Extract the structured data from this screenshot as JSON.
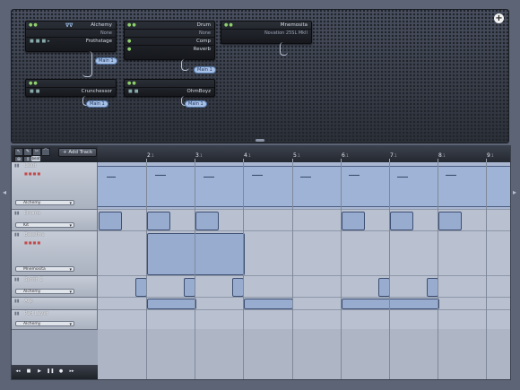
{
  "mixer": {
    "add_symbol": "+",
    "plugins": [
      {
        "name": "Alchemy",
        "sub": "None",
        "fx": "Frothstage"
      },
      {
        "name": "Drum",
        "sub": "None",
        "fx": [
          "Comp",
          "Reverb"
        ]
      },
      {
        "name": "Mnemosita",
        "sub": "Novation 25SL MkII"
      },
      {
        "name": "Crunchessor"
      },
      {
        "name": "OhmBoyz"
      }
    ],
    "outputs": [
      "Main 1",
      "Main 1",
      "Main 1",
      "Main 1"
    ]
  },
  "toolbar": {
    "add_track_label": "+ Add Track",
    "beat_label": "beat",
    "tools": [
      "pointer-tool",
      "pencil-tool",
      "scissors-tool",
      "glue-tool"
    ]
  },
  "ruler": {
    "marks": [
      {
        "n": "2",
        "s": ".1"
      },
      {
        "n": "3",
        "s": ".1"
      },
      {
        "n": "4",
        "s": ".1"
      },
      {
        "n": "5",
        "s": ".1"
      },
      {
        "n": "6",
        "s": ".1"
      },
      {
        "n": "7",
        "s": ".1"
      },
      {
        "n": "8",
        "s": ".1"
      },
      {
        "n": "9",
        "s": ".1"
      }
    ]
  },
  "tracks": [
    {
      "name": "Lead",
      "select": "Alchemy"
    },
    {
      "name": "Drums",
      "select": "Kit"
    },
    {
      "name": "Bassline",
      "select": "Mnemosita"
    },
    {
      "name": "Synth 2",
      "select": "Alchemy"
    },
    {
      "name": "Arp"
    },
    {
      "name": "Pad Layer",
      "select": "Alchemy"
    }
  ],
  "colors": {
    "accent": "#98acd0",
    "panel": "#2a2e36",
    "led": "#8fd06c"
  }
}
